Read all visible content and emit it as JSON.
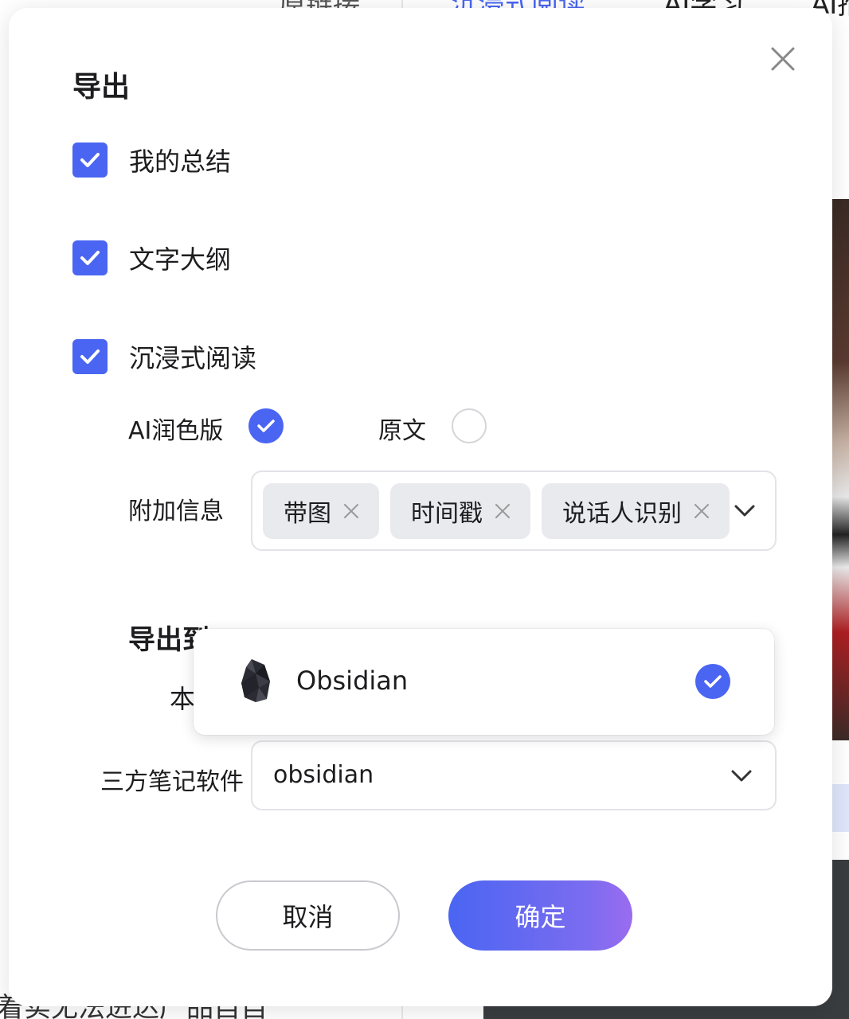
{
  "background": {
    "top_link": "原链接",
    "tabs": [
      "沉浸式阅读",
      "AI学习",
      "AI推"
    ],
    "bottom_text": "着实无法进达产品自自"
  },
  "modal": {
    "title": "导出",
    "checkboxes": [
      {
        "label": "我的总结",
        "checked": true
      },
      {
        "label": "文字大纲",
        "checked": true
      },
      {
        "label": "沉浸式阅读",
        "checked": true
      }
    ],
    "version": {
      "options": [
        {
          "label": "AI润色版",
          "selected": true
        },
        {
          "label": "原文",
          "selected": false
        }
      ]
    },
    "extra_info": {
      "label": "附加信息",
      "tags": [
        "带图",
        "时间戳",
        "说话人识别"
      ]
    },
    "export_to": {
      "title": "导出到",
      "partial_label": "本",
      "popup": {
        "option_label": "Obsidian",
        "selected": true,
        "icon": "obsidian-logo"
      },
      "third_party": {
        "label": "三方笔记软件",
        "value": "obsidian"
      }
    },
    "buttons": {
      "cancel": "取消",
      "confirm": "确定"
    }
  },
  "colors": {
    "accent": "#4a65f2",
    "gradient_end": "#9a6cf0",
    "tag_bg": "#e9eaee"
  }
}
